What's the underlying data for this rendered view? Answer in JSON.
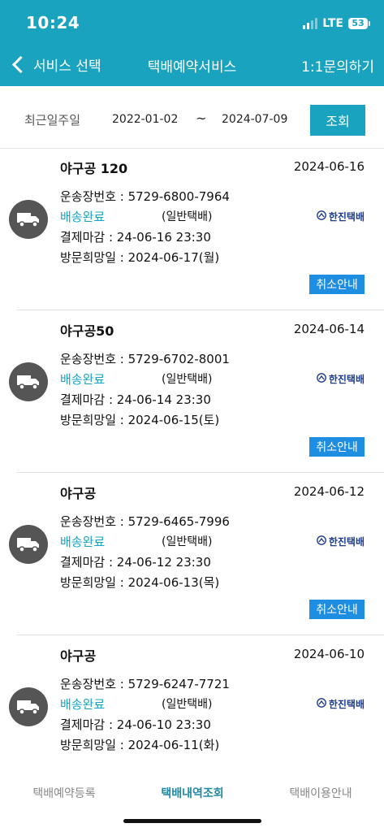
{
  "status_bar": {
    "time": "10:24",
    "network": "LTE",
    "battery": "53"
  },
  "nav": {
    "back_label": "서비스 선택",
    "title": "택배예약서비스",
    "inquiry_label": "1:1문의하기"
  },
  "filter": {
    "label": "최근일주일",
    "start_date": "2022-01-02",
    "separator": "~",
    "end_date": "2024-07-09",
    "search_label": "조회"
  },
  "orders": [
    {
      "product": "야구공 120",
      "date": "2024-06-16",
      "tracking": "운송장번호 : 5729-6800-7964",
      "status": "배송완료",
      "service": "(일반택배)",
      "carrier": "한진택배",
      "payment_deadline": "결제마감 : 24-06-16 23:30",
      "visit_date": "방문희망일 : 2024-06-17(월)",
      "cancel_label": "취소안내"
    },
    {
      "product": "야구공50",
      "date": "2024-06-14",
      "tracking": "운송장번호 : 5729-6702-8001",
      "status": "배송완료",
      "service": "(일반택배)",
      "carrier": "한진택배",
      "payment_deadline": "결제마감 : 24-06-14 23:30",
      "visit_date": "방문희망일 : 2024-06-15(토)",
      "cancel_label": "취소안내"
    },
    {
      "product": "야구공",
      "date": "2024-06-12",
      "tracking": "운송장번호 : 5729-6465-7996",
      "status": "배송완료",
      "service": "(일반택배)",
      "carrier": "한진택배",
      "payment_deadline": "결제마감 : 24-06-12 23:30",
      "visit_date": "방문희망일 : 2024-06-13(목)",
      "cancel_label": "취소안내"
    },
    {
      "product": "야구공",
      "date": "2024-06-10",
      "tracking": "운송장번호 : 5729-6247-7721",
      "status": "배송완료",
      "service": "(일반택배)",
      "carrier": "한진택배",
      "payment_deadline": "결제마감 : 24-06-10 23:30",
      "visit_date": "방문희망일 : 2024-06-11(화)",
      "cancel_label": ""
    }
  ],
  "tabs": [
    {
      "label": "택배예약등록",
      "active": false
    },
    {
      "label": "택배내역조회",
      "active": true
    },
    {
      "label": "택배이용안내",
      "active": false
    }
  ],
  "icons": {
    "order": "truck-icon",
    "back": "chevron-left-icon",
    "carrier": "hanjin-logo-icon"
  },
  "colors": {
    "header": "#1aa3bf",
    "status_text": "#1aa3bf",
    "cancel_button": "#1e8ee3",
    "active_tab": "#1f8aa3"
  }
}
